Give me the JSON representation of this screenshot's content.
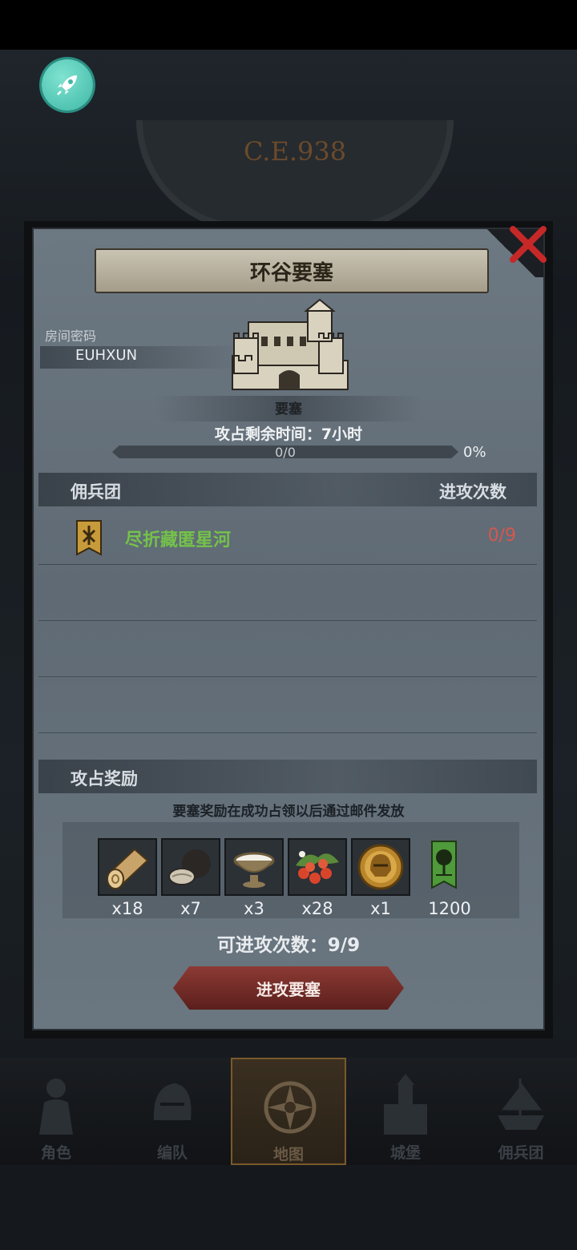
{
  "background": {
    "era_label": "C.E.938"
  },
  "dialog": {
    "title": "环谷要塞",
    "room_label": "房间密码",
    "room_code": "EUHXUN",
    "fortress_caption": "要塞",
    "capture_time": "攻占剩余时间：7小时",
    "progress_count": "0/0",
    "progress_percent": "0%",
    "progress_value": 0
  },
  "mercenary_section": {
    "header_left": "佣兵团",
    "header_right": "进攻次数",
    "rows": [
      {
        "name": "尽折藏匿星河",
        "attacks": "0/9"
      }
    ]
  },
  "rewards": {
    "title": "攻占奖励",
    "note": "要塞奖励在成功占领以后通过邮件发放",
    "items": [
      {
        "icon": "wood-log-icon",
        "qty": "x18"
      },
      {
        "icon": "truffle-icon",
        "qty": "x7"
      },
      {
        "icon": "milk-bowl-icon",
        "qty": "x3"
      },
      {
        "icon": "berries-icon",
        "qty": "x28"
      },
      {
        "icon": "golden-helmet-medal-icon",
        "qty": "x1"
      },
      {
        "icon": "tree-banner-icon",
        "qty": "1200"
      }
    ],
    "attacks_left": "可进攻次数：9/9",
    "attack_button": "进攻要塞"
  },
  "nav": {
    "items": [
      {
        "label": "角色"
      },
      {
        "label": "编队"
      },
      {
        "label": "地图"
      },
      {
        "label": "城堡"
      },
      {
        "label": "佣兵团"
      }
    ],
    "active_index": 2
  },
  "colors": {
    "accent_green": "#74c24a",
    "accent_red": "#d5574f",
    "button_red": "#8c3a34"
  }
}
